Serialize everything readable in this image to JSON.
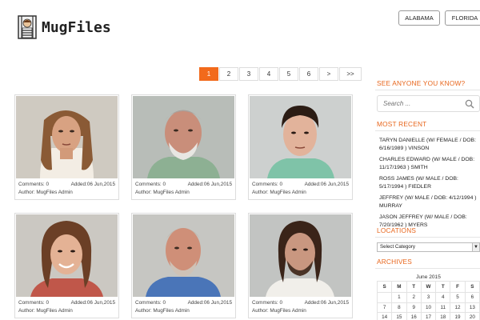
{
  "header": {
    "logo_text": "MugFiles",
    "states": [
      "ALABAMA",
      "FLORIDA"
    ]
  },
  "pagination": {
    "pages": [
      "1",
      "2",
      "3",
      "4",
      "5",
      "6",
      ">",
      ">>"
    ],
    "active": "1"
  },
  "cards": [
    {
      "comments_label": "Comments: 0",
      "added_label": "Added:06 Jun,2015",
      "author_label": "Author: MugFiles Admin"
    },
    {
      "comments_label": "Comments: 0",
      "added_label": "Added:06 Jun,2015",
      "author_label": "Author: MugFiles Admin"
    },
    {
      "comments_label": "Comments: 0",
      "added_label": "Added:06 Jun,2015",
      "author_label": "Author: MugFiles Admin"
    },
    {
      "comments_label": "Comments: 0",
      "added_label": "Added:06 Jun,2015",
      "author_label": "Author: MugFiles Admin"
    },
    {
      "comments_label": "Comments: 0",
      "added_label": "Added:06 Jun,2015",
      "author_label": "Author: MugFiles Admin"
    },
    {
      "comments_label": "Comments: 0",
      "added_label": "Added:06 Jun,2015",
      "author_label": "Author: MugFiles Admin"
    }
  ],
  "sidebar": {
    "see_anyone_heading": "SEE ANYONE YOU KNOW?",
    "search_placeholder": "Search ...",
    "most_recent_heading": "MOST RECENT",
    "recent": [
      "TARYN DANIELLE (W/ FEMALE / DOB: 6/16/1989 ) VINSON",
      "CHARLES EDWARD (W/ MALE / DOB: 11/17/1963 ) SMITH",
      "ROSS JAMES (W/ MALE / DOB: 5/17/1994 ) FIEDLER",
      "JEFFREY (W/ MALE / DOB: 4/12/1994 ) MURRAY",
      "JASON JEFFREY (W/ MALE / DOB: 7/20/1962 ) MYERS"
    ],
    "locations_heading": "LOCATIONS",
    "select_category": "Select Category",
    "archives_heading": "ARCHIVES",
    "calendar": {
      "title": "June 2015",
      "days": [
        "S",
        "M",
        "T",
        "W",
        "T",
        "F",
        "S"
      ],
      "weeks": [
        [
          "",
          "1",
          "2",
          "3",
          "4",
          "5",
          "6"
        ],
        [
          "7",
          "8",
          "9",
          "10",
          "11",
          "12",
          "13"
        ],
        [
          "14",
          "15",
          "16",
          "17",
          "18",
          "19",
          "20"
        ]
      ]
    }
  },
  "colors": {
    "accent": "#f26a1b",
    "heading": "#e8661c"
  }
}
